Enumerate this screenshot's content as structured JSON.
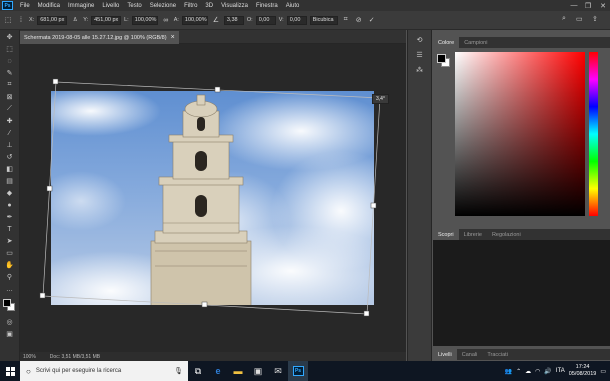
{
  "app": {
    "logo": "Ps"
  },
  "menubar": {
    "items": [
      "File",
      "Modifica",
      "Immagine",
      "Livello",
      "Testo",
      "Selezione",
      "Filtro",
      "3D",
      "Visualizza",
      "Finestra",
      "Aiuto"
    ],
    "window_controls": [
      "—",
      "❐",
      "✕"
    ]
  },
  "options": {
    "x_label": "X:",
    "x_value": "681,00 px",
    "y_label": "Y:",
    "y_value": "451,00 px",
    "w_label": "L:",
    "w_value": "100,00%",
    "h_label": "A:",
    "h_value": "100,00%",
    "angle_value": "3,38",
    "hskew_label": "O:",
    "hskew_value": "0,00",
    "vskew_label": "V:",
    "vskew_value": "0,00",
    "interpolation": "Bicubica"
  },
  "document": {
    "tab_title": "Schermata 2019-08-05 alle 15.27.12.jpg @ 100% (RGB/8)",
    "close": "×",
    "rotation_readout": "3,4°"
  },
  "status": {
    "zoom": "100%",
    "doc_size": "Doc: 3,51 MB/3,51 MB"
  },
  "panels": {
    "color_tabs": [
      "Colore",
      "Campioni"
    ],
    "mid_tabs": [
      "Scopri",
      "Librerie",
      "Regolazioni"
    ],
    "bottom_tabs": [
      "Livelli",
      "Canali",
      "Tracciati"
    ]
  },
  "taskbar": {
    "search_placeholder": "Scrivi qui per eseguire la ricerca",
    "lang": "ITA",
    "time": "17:24",
    "date": "05/08/2019"
  },
  "colors": {
    "foreground": "#000000",
    "background": "#ffffff",
    "ps_blue": "#31a8ff",
    "taskbar": "#0e1622",
    "picker_hue": "#ff0000"
  },
  "icons": [
    "move",
    "marquee",
    "lasso",
    "quick-select",
    "crop",
    "frame",
    "eyedropper",
    "healing",
    "brush",
    "stamp",
    "history-brush",
    "eraser",
    "gradient",
    "blur",
    "dodge",
    "pen",
    "type",
    "path-select",
    "shape",
    "hand",
    "zoom"
  ]
}
